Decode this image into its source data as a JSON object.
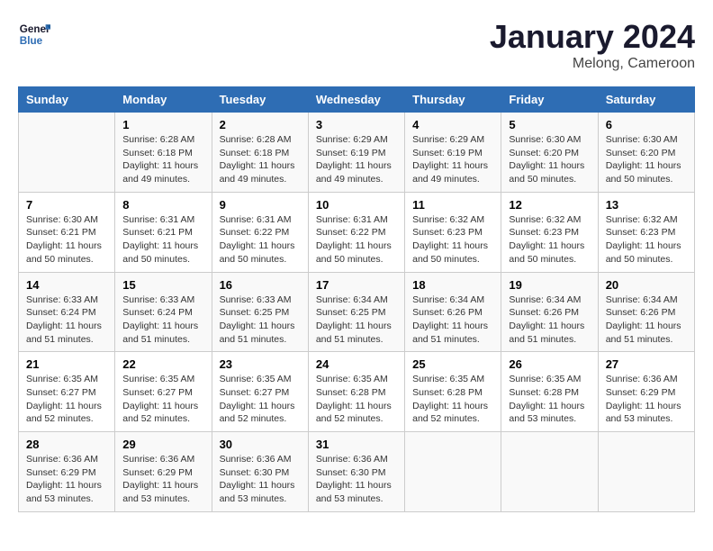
{
  "logo": {
    "line1": "General",
    "line2": "Blue"
  },
  "title": "January 2024",
  "subtitle": "Melong, Cameroon",
  "days_header": [
    "Sunday",
    "Monday",
    "Tuesday",
    "Wednesday",
    "Thursday",
    "Friday",
    "Saturday"
  ],
  "weeks": [
    [
      {
        "day": "",
        "info": ""
      },
      {
        "day": "1",
        "info": "Sunrise: 6:28 AM\nSunset: 6:18 PM\nDaylight: 11 hours\nand 49 minutes."
      },
      {
        "day": "2",
        "info": "Sunrise: 6:28 AM\nSunset: 6:18 PM\nDaylight: 11 hours\nand 49 minutes."
      },
      {
        "day": "3",
        "info": "Sunrise: 6:29 AM\nSunset: 6:19 PM\nDaylight: 11 hours\nand 49 minutes."
      },
      {
        "day": "4",
        "info": "Sunrise: 6:29 AM\nSunset: 6:19 PM\nDaylight: 11 hours\nand 49 minutes."
      },
      {
        "day": "5",
        "info": "Sunrise: 6:30 AM\nSunset: 6:20 PM\nDaylight: 11 hours\nand 50 minutes."
      },
      {
        "day": "6",
        "info": "Sunrise: 6:30 AM\nSunset: 6:20 PM\nDaylight: 11 hours\nand 50 minutes."
      }
    ],
    [
      {
        "day": "7",
        "info": "Sunrise: 6:30 AM\nSunset: 6:21 PM\nDaylight: 11 hours\nand 50 minutes."
      },
      {
        "day": "8",
        "info": "Sunrise: 6:31 AM\nSunset: 6:21 PM\nDaylight: 11 hours\nand 50 minutes."
      },
      {
        "day": "9",
        "info": "Sunrise: 6:31 AM\nSunset: 6:22 PM\nDaylight: 11 hours\nand 50 minutes."
      },
      {
        "day": "10",
        "info": "Sunrise: 6:31 AM\nSunset: 6:22 PM\nDaylight: 11 hours\nand 50 minutes."
      },
      {
        "day": "11",
        "info": "Sunrise: 6:32 AM\nSunset: 6:23 PM\nDaylight: 11 hours\nand 50 minutes."
      },
      {
        "day": "12",
        "info": "Sunrise: 6:32 AM\nSunset: 6:23 PM\nDaylight: 11 hours\nand 50 minutes."
      },
      {
        "day": "13",
        "info": "Sunrise: 6:32 AM\nSunset: 6:23 PM\nDaylight: 11 hours\nand 50 minutes."
      }
    ],
    [
      {
        "day": "14",
        "info": "Sunrise: 6:33 AM\nSunset: 6:24 PM\nDaylight: 11 hours\nand 51 minutes."
      },
      {
        "day": "15",
        "info": "Sunrise: 6:33 AM\nSunset: 6:24 PM\nDaylight: 11 hours\nand 51 minutes."
      },
      {
        "day": "16",
        "info": "Sunrise: 6:33 AM\nSunset: 6:25 PM\nDaylight: 11 hours\nand 51 minutes."
      },
      {
        "day": "17",
        "info": "Sunrise: 6:34 AM\nSunset: 6:25 PM\nDaylight: 11 hours\nand 51 minutes."
      },
      {
        "day": "18",
        "info": "Sunrise: 6:34 AM\nSunset: 6:26 PM\nDaylight: 11 hours\nand 51 minutes."
      },
      {
        "day": "19",
        "info": "Sunrise: 6:34 AM\nSunset: 6:26 PM\nDaylight: 11 hours\nand 51 minutes."
      },
      {
        "day": "20",
        "info": "Sunrise: 6:34 AM\nSunset: 6:26 PM\nDaylight: 11 hours\nand 51 minutes."
      }
    ],
    [
      {
        "day": "21",
        "info": "Sunrise: 6:35 AM\nSunset: 6:27 PM\nDaylight: 11 hours\nand 52 minutes."
      },
      {
        "day": "22",
        "info": "Sunrise: 6:35 AM\nSunset: 6:27 PM\nDaylight: 11 hours\nand 52 minutes."
      },
      {
        "day": "23",
        "info": "Sunrise: 6:35 AM\nSunset: 6:27 PM\nDaylight: 11 hours\nand 52 minutes."
      },
      {
        "day": "24",
        "info": "Sunrise: 6:35 AM\nSunset: 6:28 PM\nDaylight: 11 hours\nand 52 minutes."
      },
      {
        "day": "25",
        "info": "Sunrise: 6:35 AM\nSunset: 6:28 PM\nDaylight: 11 hours\nand 52 minutes."
      },
      {
        "day": "26",
        "info": "Sunrise: 6:35 AM\nSunset: 6:28 PM\nDaylight: 11 hours\nand 53 minutes."
      },
      {
        "day": "27",
        "info": "Sunrise: 6:36 AM\nSunset: 6:29 PM\nDaylight: 11 hours\nand 53 minutes."
      }
    ],
    [
      {
        "day": "28",
        "info": "Sunrise: 6:36 AM\nSunset: 6:29 PM\nDaylight: 11 hours\nand 53 minutes."
      },
      {
        "day": "29",
        "info": "Sunrise: 6:36 AM\nSunset: 6:29 PM\nDaylight: 11 hours\nand 53 minutes."
      },
      {
        "day": "30",
        "info": "Sunrise: 6:36 AM\nSunset: 6:30 PM\nDaylight: 11 hours\nand 53 minutes."
      },
      {
        "day": "31",
        "info": "Sunrise: 6:36 AM\nSunset: 6:30 PM\nDaylight: 11 hours\nand 53 minutes."
      },
      {
        "day": "",
        "info": ""
      },
      {
        "day": "",
        "info": ""
      },
      {
        "day": "",
        "info": ""
      }
    ]
  ]
}
